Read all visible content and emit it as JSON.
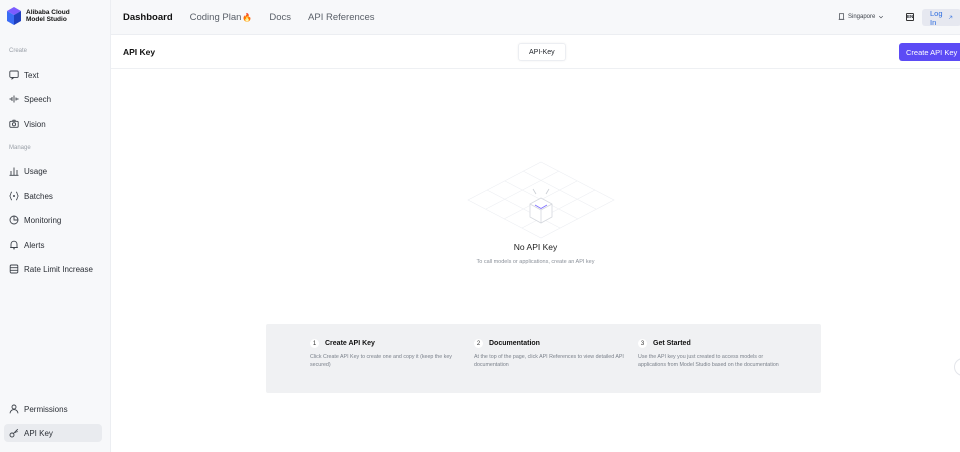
{
  "brand": {
    "line1": "Alibaba Cloud",
    "line2": "Model Studio"
  },
  "sidebar": {
    "section_create": "Create",
    "section_manage": "Manage",
    "items": [
      {
        "label": "Text",
        "icon": "chat-icon"
      },
      {
        "label": "Speech",
        "icon": "waveform-icon"
      },
      {
        "label": "Vision",
        "icon": "camera-icon"
      },
      {
        "label": "Usage",
        "icon": "bar-chart-icon"
      },
      {
        "label": "Batches",
        "icon": "braces-icon"
      },
      {
        "label": "Monitoring",
        "icon": "pie-chart-icon"
      },
      {
        "label": "Alerts",
        "icon": "bell-icon"
      },
      {
        "label": "Rate Limit Increase",
        "icon": "database-icon"
      },
      {
        "label": "Permissions",
        "icon": "user-icon"
      },
      {
        "label": "API Key",
        "icon": "key-icon"
      }
    ]
  },
  "topnav": {
    "dashboard": "Dashboard",
    "coding_plan": "Coding Plan",
    "docs": "Docs",
    "api_references": "API References"
  },
  "header_right": {
    "region": "Singapore",
    "lang": "EN",
    "login": "Log In"
  },
  "page": {
    "title": "API Key",
    "tab": "API-Key",
    "create_button": "Create API Key",
    "empty_title": "No API Key",
    "empty_subtitle": "To call models or applications, create an API key"
  },
  "steps": [
    {
      "num": "1",
      "title": "Create API Key",
      "desc": "Click Create API Key to create one and copy it (keep the key secured)"
    },
    {
      "num": "2",
      "title": "Documentation",
      "desc": "At the top of the page, click API References to view detailed API documentation"
    },
    {
      "num": "3",
      "title": "Get Started",
      "desc": "Use the API key you just created to access models or applications from Model Studio based on the documentation"
    }
  ],
  "colors": {
    "primary": "#5c4bf5",
    "link": "#2d6cdf",
    "fire": "#ff7a1a"
  }
}
